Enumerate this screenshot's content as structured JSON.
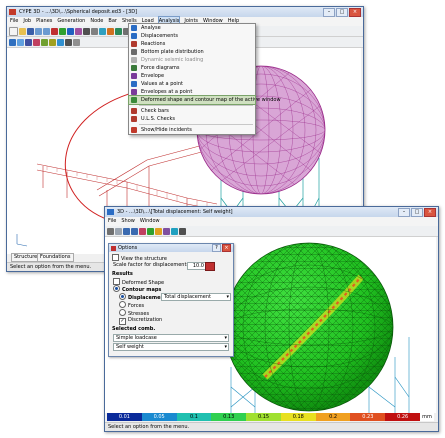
{
  "back_window": {
    "title": "CYPE 3D - ...\\3D\\...\\Spherical deposit.ed3 - [3D]",
    "menu": [
      "File",
      "Job",
      "Planes",
      "Generation",
      "Node",
      "Bar",
      "Shells",
      "Load",
      "Analysis",
      "Joints",
      "Window",
      "Help"
    ],
    "tabs": [
      "Structure",
      "Foundations"
    ],
    "status": "Select an option from the menu."
  },
  "analysis_menu": {
    "items": [
      {
        "label": "Analyse",
        "icon": "analyse-icon",
        "color": "#2a6cc4"
      },
      {
        "label": "Displacements",
        "icon": "displacements-icon",
        "color": "#2a6cc4"
      },
      {
        "label": "Reactions",
        "icon": "reactions-icon",
        "color": "#b03a2e"
      },
      {
        "label": "Bottom plate distribution",
        "icon": "plate-icon",
        "color": "#6a6a6a"
      },
      {
        "label": "Dynamic seismic loading",
        "icon": "seismic-icon",
        "color": "#9a9a9a",
        "disabled": true
      },
      {
        "label": "Force diagrams",
        "icon": "force-diagram-icon",
        "color": "#3a7a3a"
      },
      {
        "label": "Envelope",
        "icon": "envelope-icon",
        "color": "#7a3a9a"
      },
      {
        "label": "Values at a point",
        "icon": "values-point-icon",
        "color": "#2a6cc4"
      },
      {
        "label": "Envelopes at a point",
        "icon": "envelopes-point-icon",
        "color": "#7a3a9a"
      },
      {
        "label": "Deformed shape and contour map of the active window",
        "icon": "deformed-shape-icon",
        "color": "#3a8a3a",
        "highlighted": true
      },
      {
        "label": "Check bars",
        "icon": "check-bars-icon",
        "color": "#b03a2e"
      },
      {
        "label": "U.L.S. Checks",
        "icon": "uls-checks-icon",
        "color": "#b03a2e"
      },
      {
        "label": "Show/Hide incidents",
        "icon": "incidents-icon",
        "color": "#c0392b"
      }
    ]
  },
  "front_window": {
    "title": "3D - ...\\3D\\...\\[Total displacement: Self weight]",
    "menu": [
      "File",
      "Show",
      "Window"
    ],
    "status": "Select an option from the menu."
  },
  "options_dialog": {
    "title": "Options",
    "view_structure": "View the structure",
    "scale_label": "Scale factor for displacements",
    "scale_value": "10.0",
    "results_heading": "Results",
    "deformed_shape": "Deformed Shape",
    "contour_maps": "Contour maps",
    "displacements": "Displacements",
    "displacement_type": "Total displacement",
    "forces": "Forces",
    "stresses": "Stresses",
    "discretization": "Discretization",
    "selected_comb": "Selected comb.",
    "combination_type": "Simple loadcase",
    "loadcase": "Self weight"
  },
  "legend": {
    "values": [
      "0.01",
      "0.05",
      "0.1",
      "0.13",
      "0.15",
      "0.18",
      "0.2",
      "0.23",
      "0.26"
    ],
    "unit": "mm",
    "colors": [
      "#0a2a9a",
      "#1a8ad0",
      "#20c0b0",
      "#30d050",
      "#a0e030",
      "#e8e020",
      "#f0a020",
      "#e05020",
      "#c01010"
    ]
  }
}
